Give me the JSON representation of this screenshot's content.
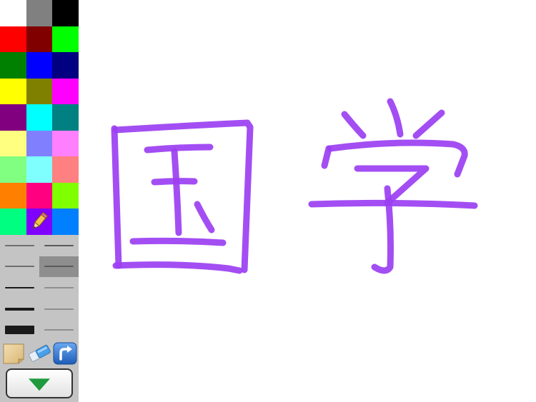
{
  "app": {
    "brush_color": "#9b3ff2"
  },
  "palette": {
    "colors": [
      "#ffffff",
      "#808080",
      "#000000",
      "#ff0000",
      "#800000",
      "#00ff00",
      "#008000",
      "#0000ff",
      "#000080",
      "#ffff00",
      "#808000",
      "#ff00ff",
      "#800080",
      "#00ffff",
      "#008080",
      "#ffff80",
      "#8080ff",
      "#ff80ff",
      "#80ff80",
      "#80ffff",
      "#ff8080",
      "#ff8000",
      "#ff0080",
      "#80ff00",
      "#00ff80",
      "#8000ff",
      "#0080ff"
    ],
    "selected_index": 25,
    "selected_icon": "pencil-icon"
  },
  "stroke_widths": {
    "options": [
      1,
      2,
      1,
      2,
      2,
      1,
      4,
      1,
      12,
      1
    ],
    "selected_index": 3
  },
  "tools": [
    {
      "name": "paper-icon"
    },
    {
      "name": "eraser-icon"
    },
    {
      "name": "undo-icon"
    }
  ],
  "collapse": {
    "icon": "triangle-down-icon",
    "color": "#1f9a3d"
  }
}
